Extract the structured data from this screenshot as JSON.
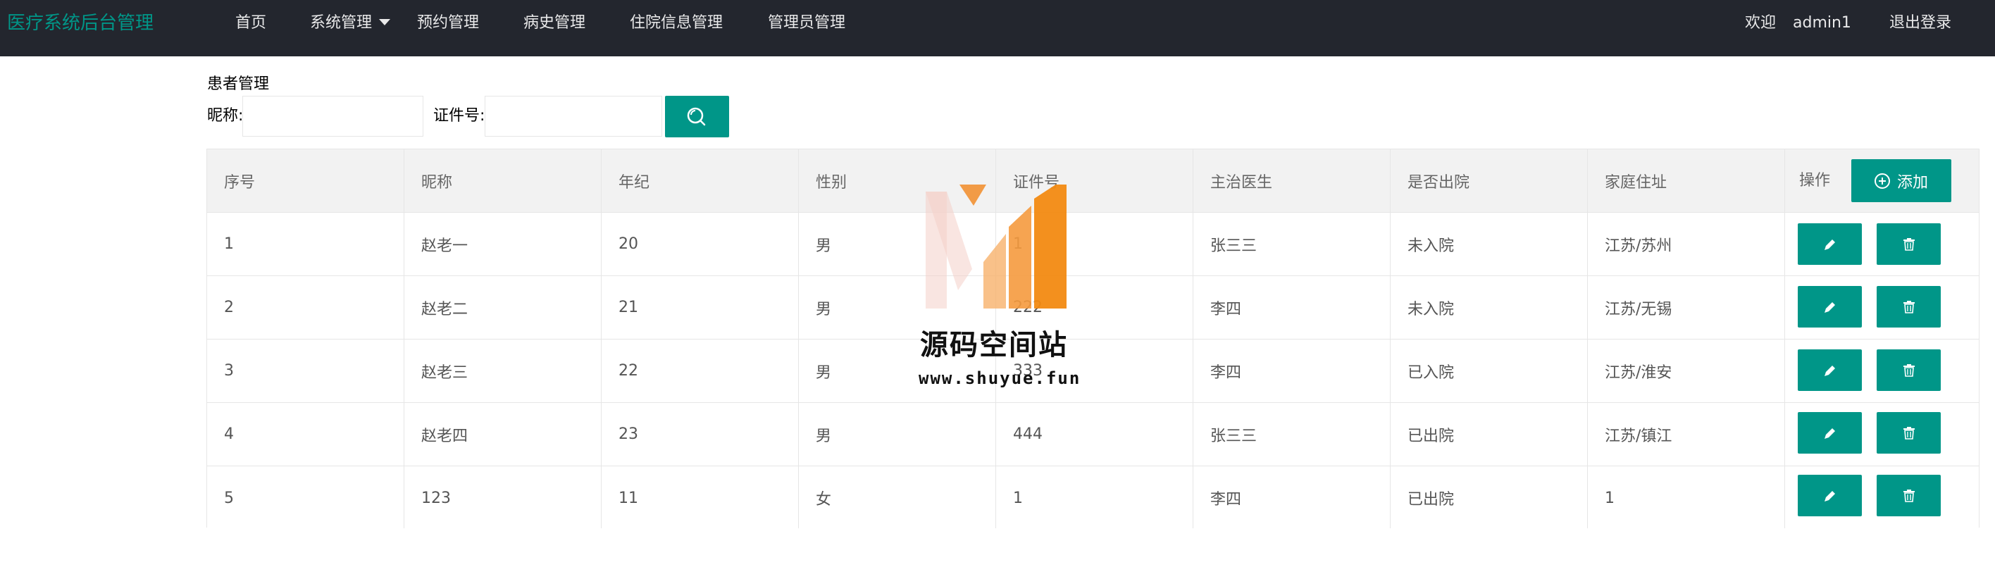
{
  "nav": {
    "brand": "医疗系统后台管理",
    "items": [
      "首页",
      "系统管理",
      "预约管理",
      "病史管理",
      "住院信息管理",
      "管理员管理"
    ],
    "welcome": "欢迎",
    "username": "admin1",
    "logout": "退出登录"
  },
  "page": {
    "title": "患者管理",
    "filters": {
      "nickname_label": "昵称:",
      "nickname_value": "",
      "id_label": "证件号:",
      "id_value": ""
    },
    "search_icon": "search-icon"
  },
  "table": {
    "headers": [
      "序号",
      "昵称",
      "年纪",
      "性别",
      "证件号",
      "主治医生",
      "是否出院",
      "家庭住址",
      "操作"
    ],
    "add_label": "添加",
    "rows": [
      [
        "1",
        "赵老一",
        "20",
        "男",
        "1",
        "张三三",
        "未入院",
        "江苏/苏州"
      ],
      [
        "2",
        "赵老二",
        "21",
        "男",
        "222",
        "李四",
        "未入院",
        "江苏/无锡"
      ],
      [
        "3",
        "赵老三",
        "22",
        "男",
        "333",
        "李四",
        "已入院",
        "江苏/淮安"
      ],
      [
        "4",
        "赵老四",
        "23",
        "男",
        "444",
        "张三三",
        "已出院",
        "江苏/镇江"
      ],
      [
        "5",
        "123",
        "11",
        "女",
        "1",
        "李四",
        "已出院",
        "1"
      ]
    ],
    "edit_icon": "pencil-icon",
    "delete_icon": "trash-icon"
  },
  "watermark": {
    "title": "源码空间站",
    "url": "www.shuyue.fun"
  },
  "colors": {
    "nav_bg": "#23262e",
    "accent": "#009688",
    "header_bg": "#f2f2f2",
    "border": "#e6e6e6"
  }
}
